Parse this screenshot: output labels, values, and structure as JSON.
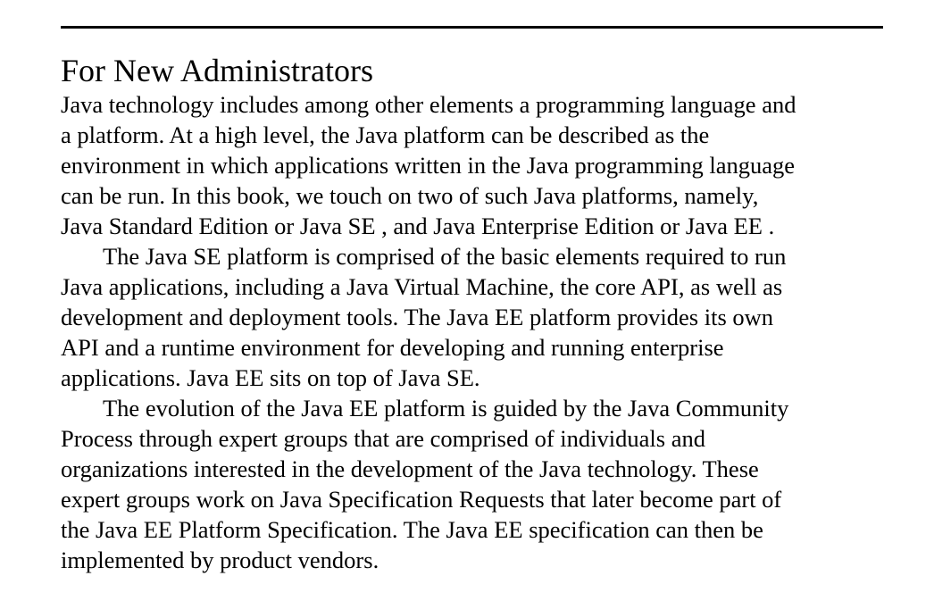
{
  "section": {
    "heading": "For New Administrators",
    "paragraphs": [
      {
        "lines": [
          "Java technology includes among other elements a programming language and",
          "a platform. At a high level, the Java platform can be described as the",
          "environment in which applications written in the Java programming language",
          "can be run. In this book, we touch on two of such Java platforms, namely,",
          "Java Standard Edition or Java SE , and Java Enterprise Edition or Java EE ."
        ]
      },
      {
        "lines": [
          "The Java SE platform is comprised of the basic elements required to run",
          "Java applications, including a Java Virtual Machine, the core API, as well as",
          "development and deployment tools. The Java EE platform provides its own",
          "API and a runtime environment for developing and running enterprise",
          "applications. Java EE sits on top of Java SE."
        ]
      },
      {
        "lines": [
          "The evolution of the Java EE platform is guided by the Java Community",
          "Process through expert groups that are comprised of individuals and",
          "organizations interested in the development of the Java technology. These",
          "expert groups work on Java Specification Requests that later become part of",
          "the Java EE Platform Specification. The Java EE specification can then be",
          "implemented by product vendors."
        ]
      }
    ]
  }
}
